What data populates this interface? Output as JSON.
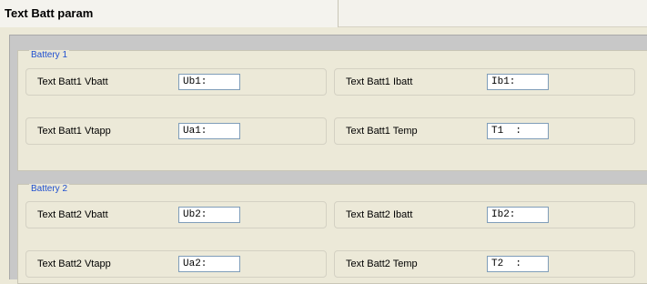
{
  "title": "Text Batt param",
  "sections": [
    {
      "legend": "Battery 1",
      "fields": [
        {
          "label": "Text Batt1 Vbatt",
          "value": "Ub1:"
        },
        {
          "label": "Text Batt1 Ibatt",
          "value": "Ib1:"
        },
        {
          "label": "Text Batt1 Vtapp",
          "value": "Ua1:"
        },
        {
          "label": "Text Batt1 Temp",
          "value": "T1  :"
        }
      ]
    },
    {
      "legend": "Battery 2",
      "fields": [
        {
          "label": "Text Batt2 Vbatt",
          "value": "Ub2:"
        },
        {
          "label": "Text Batt2 Ibatt",
          "value": "Ib2:"
        },
        {
          "label": "Text Batt2 Vtapp",
          "value": "Ua2:"
        },
        {
          "label": "Text Batt2 Temp",
          "value": "T2  :"
        }
      ]
    }
  ]
}
